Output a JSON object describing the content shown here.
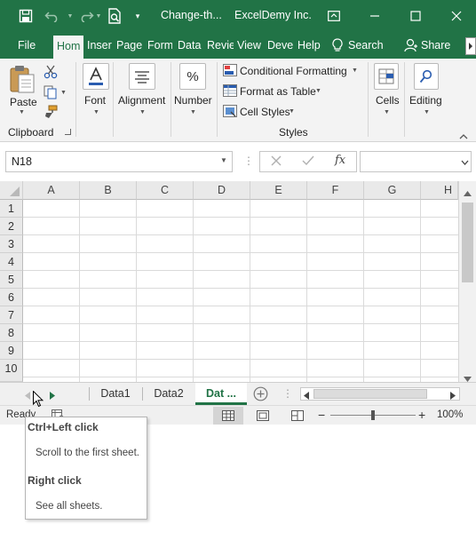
{
  "window": {
    "doc_title": "Change-th...",
    "app_title": "ExcelDemy Inc."
  },
  "tabs": [
    {
      "label": "File",
      "active": false
    },
    {
      "label": "Hom",
      "active": true
    },
    {
      "label": "Inser",
      "active": false
    },
    {
      "label": "Page",
      "active": false
    },
    {
      "label": "Form",
      "active": false
    },
    {
      "label": "Data",
      "active": false
    },
    {
      "label": "Revie",
      "active": false
    },
    {
      "label": "View",
      "active": false
    },
    {
      "label": "Deve",
      "active": false
    },
    {
      "label": "Help",
      "active": false
    }
  ],
  "search_label": "Search",
  "share_label": "Share",
  "ribbon": {
    "paste": "Paste",
    "clipboard": "Clipboard",
    "font": "Font",
    "alignment": "Alignment",
    "number": "Number",
    "number_icon": "%",
    "conditional_formatting": "Conditional Formatting",
    "format_as_table": "Format as Table",
    "cell_styles": "Cell Styles",
    "styles": "Styles",
    "cells": "Cells",
    "editing": "Editing"
  },
  "formula_bar": {
    "name_box": "N18",
    "fx": "fx",
    "formula": ""
  },
  "columns": [
    "A",
    "B",
    "C",
    "D",
    "E",
    "F",
    "G",
    "H"
  ],
  "rows": [
    "1",
    "2",
    "3",
    "4",
    "5",
    "6",
    "7",
    "8",
    "9",
    "10"
  ],
  "sheets": [
    {
      "name": "Data1",
      "active": false
    },
    {
      "name": "Data2",
      "active": false
    },
    {
      "name": "Dat ...",
      "active": true
    }
  ],
  "status": {
    "ready": "Ready",
    "zoom": "100%",
    "zoom_level": 0.5
  },
  "tooltip": {
    "heading1": "Ctrl+Left click",
    "text1": "Scroll to the first sheet.",
    "heading2": "Right click",
    "text2": "See all sheets."
  },
  "colors": {
    "brand": "#217346",
    "ribbon_bg": "#f3f3f3"
  },
  "icons": [
    "save-icon",
    "undo-icon",
    "redo-icon",
    "print-preview-icon",
    "ribbon-display-icon",
    "minimize-icon",
    "maximize-icon",
    "close-icon",
    "lightbulb-icon",
    "person-icon",
    "cut-icon",
    "copy-icon",
    "format-painter-icon",
    "fx-icon",
    "mouse-cursor-icon"
  ]
}
